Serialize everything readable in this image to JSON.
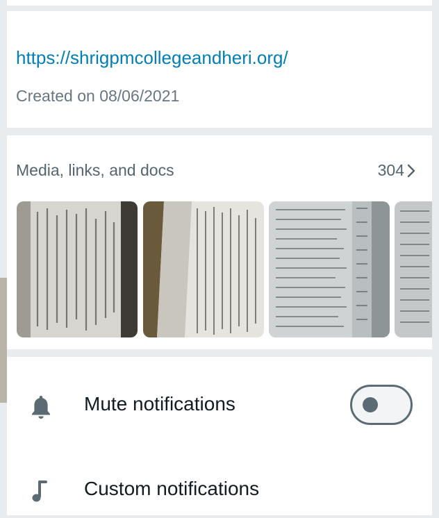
{
  "group_info": {
    "link": "https://shrigpmcollegeandheri.org/",
    "created": "Created on 08/06/2021"
  },
  "media": {
    "title": "Media, links, and docs",
    "count": "304",
    "thumbnails": [
      {
        "name": "document-photo-1",
        "icon": "document-image"
      },
      {
        "name": "document-photo-2",
        "icon": "document-image"
      },
      {
        "name": "document-photo-3",
        "icon": "document-image"
      },
      {
        "name": "document-photo-4",
        "icon": "document-image"
      }
    ]
  },
  "settings": {
    "mute": {
      "label": "Mute notifications",
      "icon": "bell-icon",
      "toggle_on": false
    },
    "custom": {
      "label": "Custom notifications",
      "icon": "music-note-icon"
    }
  },
  "colors": {
    "link": "#027eb5",
    "secondary_text": "#667781",
    "primary_text": "#111b21",
    "icon": "#5b6b74",
    "background": "#e9ecef"
  }
}
